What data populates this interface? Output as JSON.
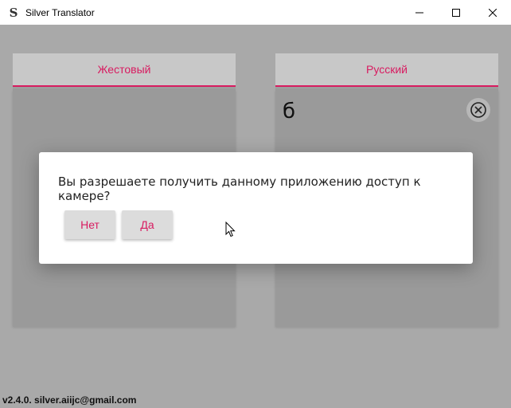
{
  "window": {
    "title": "Silver Translator",
    "app_icon_letter": "S",
    "controls": [
      "minimize-icon",
      "maximize-icon",
      "close-icon"
    ]
  },
  "left_panel": {
    "tab_label": "Жестовый"
  },
  "right_panel": {
    "tab_label": "Русский",
    "output_text": "б",
    "clear_icon": "circle-x-icon"
  },
  "footer": {
    "text": "v2.4.0. silver.aiijc@gmail.com"
  },
  "dialog": {
    "question": "Вы разрешаете получить данному приложению доступ к камере?",
    "no_label": "Нет",
    "yes_label": "Да"
  },
  "colors": {
    "accent": "#d81b60",
    "overlay_background": "#a9a9a9",
    "dialog_background": "#ffffff"
  }
}
